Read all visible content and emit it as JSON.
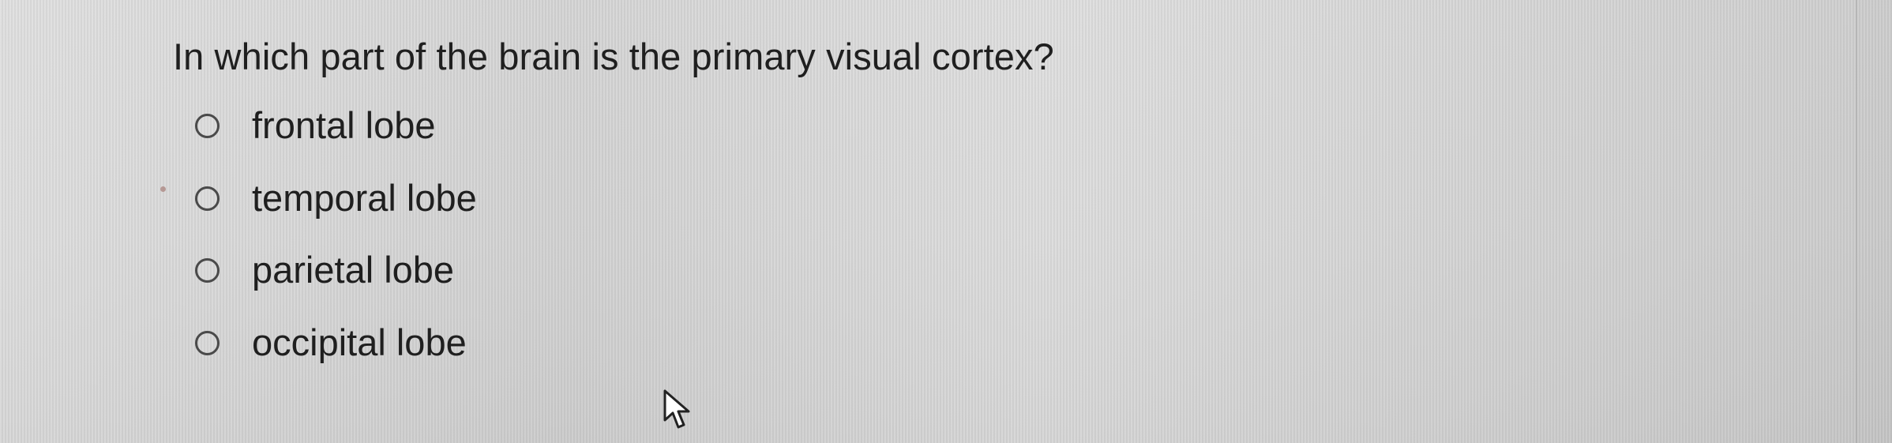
{
  "question": {
    "text": "In which part of the brain is the primary visual cortex?"
  },
  "options": [
    {
      "label": "frontal lobe",
      "selected": false
    },
    {
      "label": "temporal lobe",
      "selected": false
    },
    {
      "label": "parietal lobe",
      "selected": false
    },
    {
      "label": "occipital lobe",
      "selected": false
    }
  ],
  "icons": {
    "cursor": "mouse-pointer-icon"
  },
  "colors": {
    "background": "#d8d8d8",
    "text": "#1f1f1f",
    "radio_border": "#4a4a4a"
  }
}
